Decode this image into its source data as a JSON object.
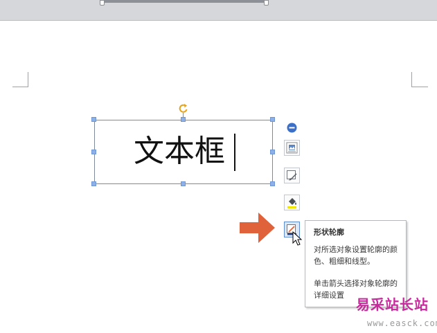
{
  "textbox": {
    "text": "文本框"
  },
  "tooltip": {
    "title": "形状轮廓",
    "description": "对所选对象设置轮廓的颜色、粗细和线型。",
    "hint": "单击箭头选择对象轮廓的详细设置"
  },
  "watermark": {
    "brand": "易采站长站",
    "url": "www.easck.com"
  },
  "toolbar": {
    "buttons": [
      {
        "icon": "layout-options-icon"
      },
      {
        "icon": "shape-edit-icon"
      },
      {
        "icon": "shape-fill-icon"
      },
      {
        "icon": "shape-outline-icon",
        "active": true
      }
    ]
  },
  "colors": {
    "handle": "#8db0e6",
    "rotate_handle": "#e6a21c",
    "arrow": "#e0623a",
    "watermark": "#c62a9c",
    "fill_swatch": "#f2e700",
    "outline_swatch": "#e0623a"
  }
}
